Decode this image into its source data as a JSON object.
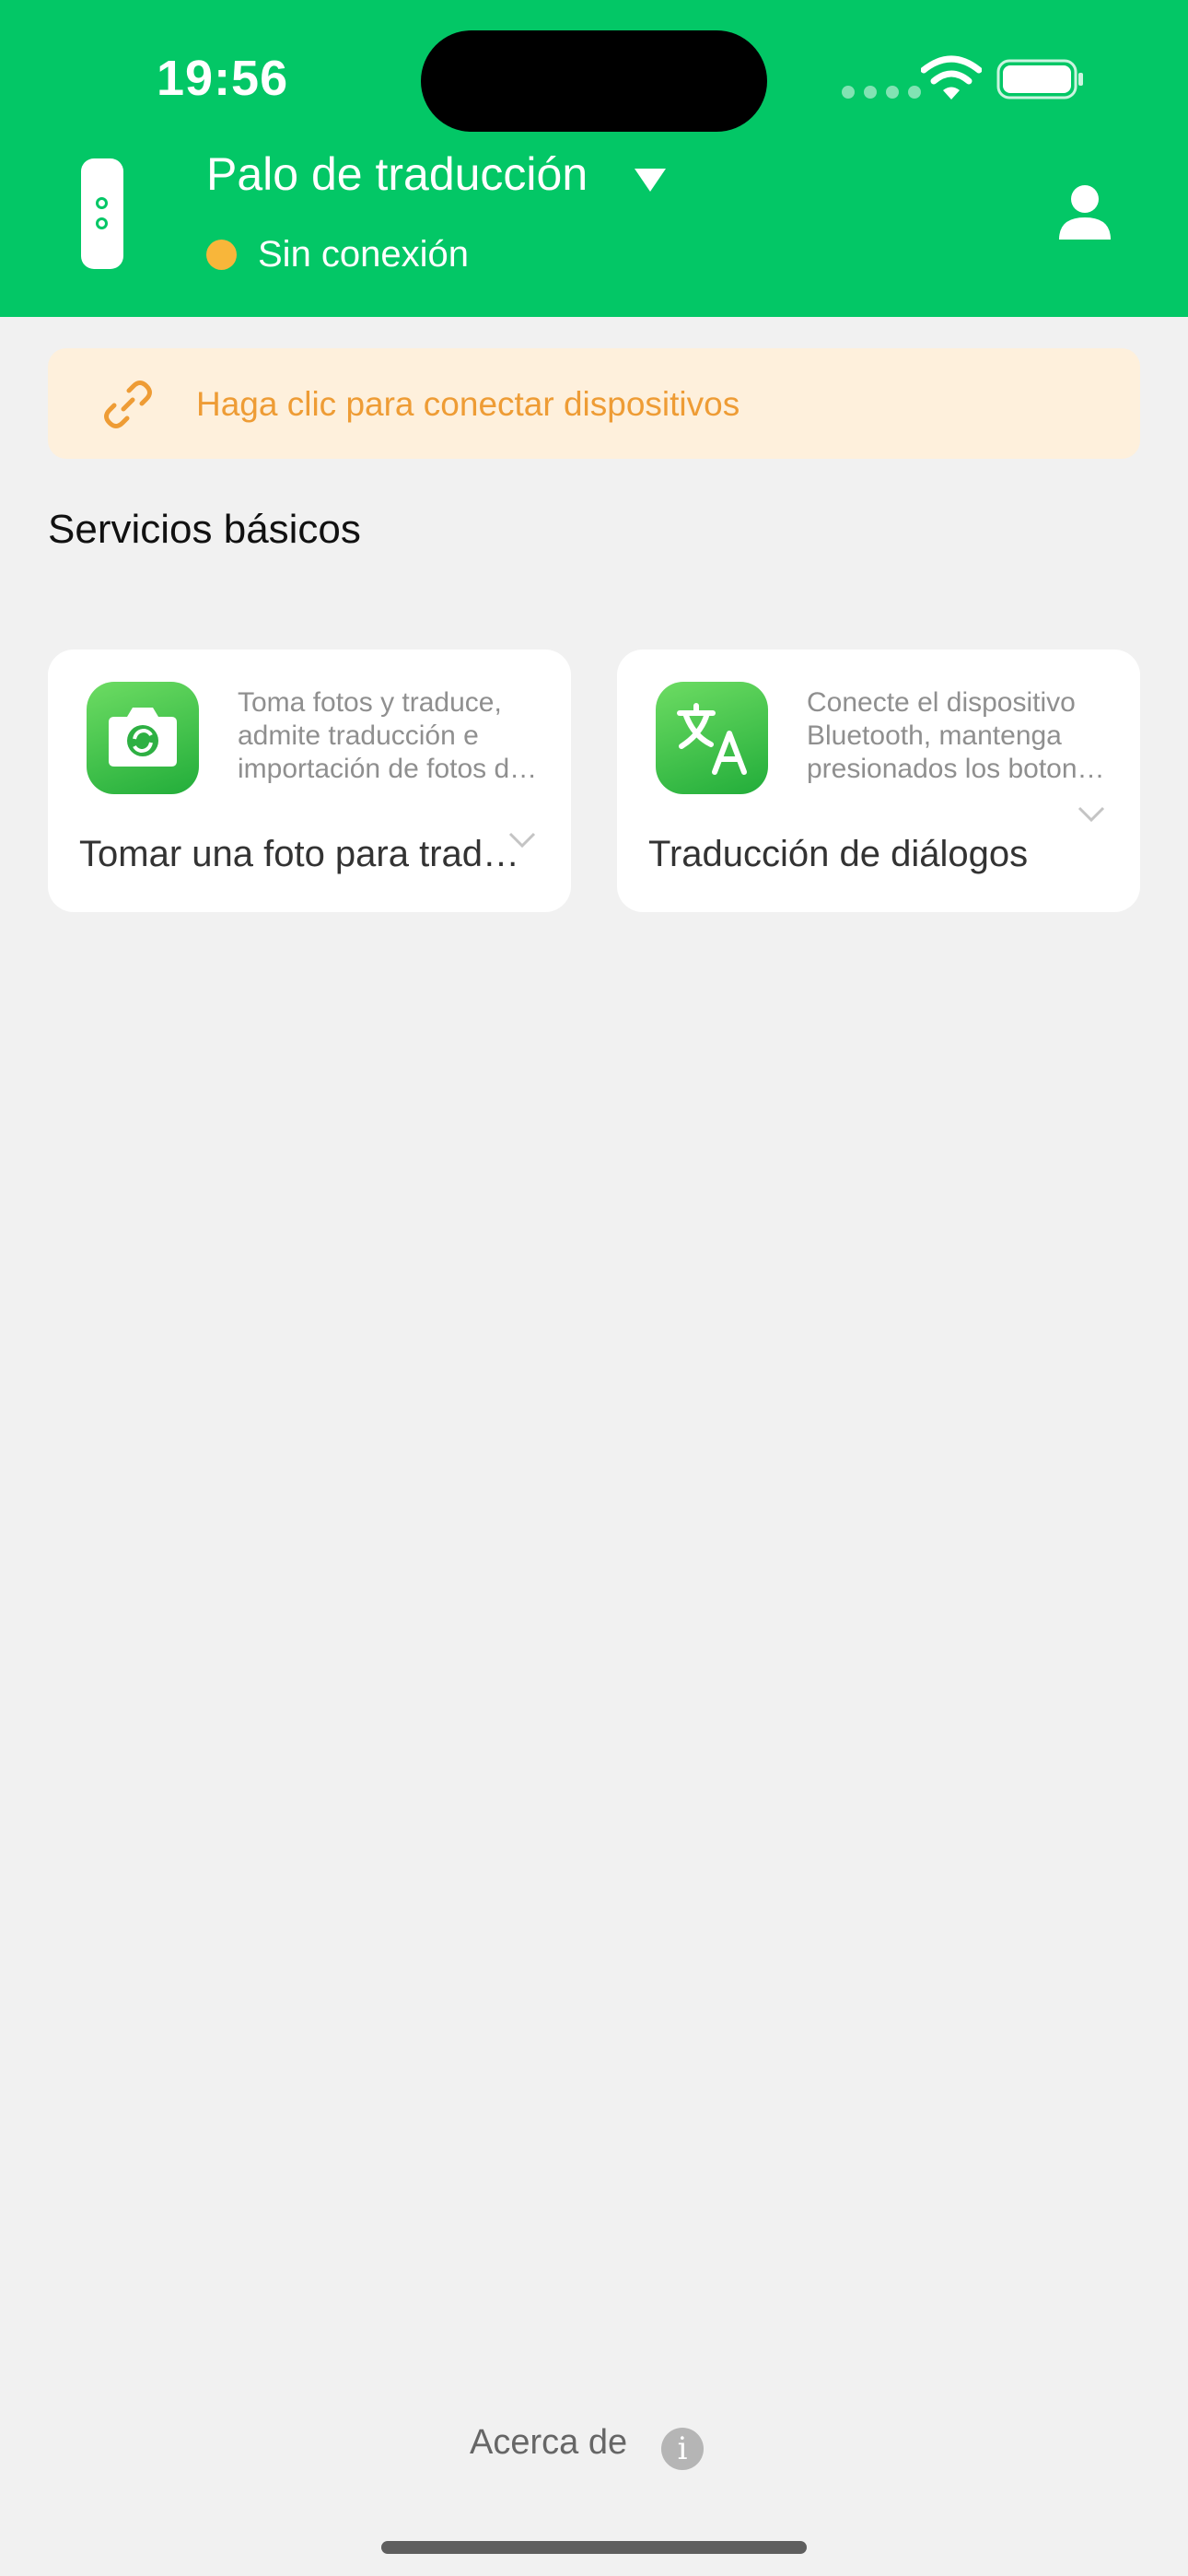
{
  "status_bar": {
    "time": "19:56"
  },
  "header": {
    "app_title": "Palo de traducción",
    "connection_status": "Sin conexión",
    "status_color": "#f8b63a",
    "brand_color": "#03c766"
  },
  "banner": {
    "icon": "link-icon",
    "text": "Haga clic para conectar dispositivos"
  },
  "section": {
    "title": "Servicios básicos"
  },
  "cards": [
    {
      "icon": "camera-translate-icon",
      "description": "Toma fotos y traduce, admite traducción e importación de fotos de álbumes",
      "title": "Tomar una foto para traducir"
    },
    {
      "icon": "translate-icon",
      "description": "Conecte el dispositivo Bluetooth, mantenga presionados los botones para traducir",
      "title": "Traducción de diálogos"
    }
  ],
  "footer": {
    "about_label": "Acerca de",
    "info_glyph": "i"
  }
}
